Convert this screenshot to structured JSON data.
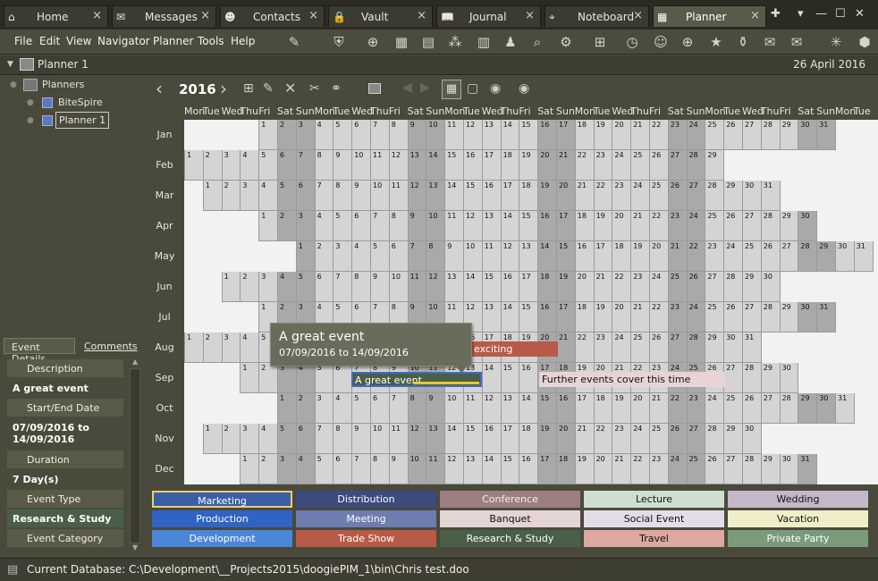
{
  "tabs": [
    {
      "label": "Home",
      "icon": "home-icon",
      "glyph": "⌂",
      "active": false
    },
    {
      "label": "Messages",
      "icon": "envelope-icon",
      "glyph": "✉",
      "active": false
    },
    {
      "label": "Contacts",
      "icon": "contacts-icon",
      "glyph": "☻",
      "active": false
    },
    {
      "label": "Vault",
      "icon": "lock-icon",
      "glyph": "🔒",
      "active": false
    },
    {
      "label": "Journal",
      "icon": "book-icon",
      "glyph": "📖",
      "active": false
    },
    {
      "label": "Noteboard",
      "icon": "pin-icon",
      "glyph": "⌖",
      "active": false
    },
    {
      "label": "Planner",
      "icon": "planner-icon",
      "glyph": "▦",
      "active": true
    }
  ],
  "menu": [
    "File",
    "Edit",
    "View",
    "Navigator",
    "Planner",
    "Tools",
    "Help"
  ],
  "title": {
    "name": "Planner 1",
    "date": "26 April 2016"
  },
  "tree": {
    "root": "Planners",
    "items": [
      "BiteSpire",
      "Planner 1"
    ]
  },
  "calendar": {
    "year": "2016",
    "day_headers": [
      "Mon",
      "Tue",
      "Wed",
      "Thu",
      "Fri",
      "Sat",
      "Sun"
    ],
    "months": [
      "Jan",
      "Feb",
      "Mar",
      "Apr",
      "May",
      "Jun",
      "Jul",
      "Aug",
      "Sep",
      "Oct",
      "Nov",
      "Dec"
    ]
  },
  "detail": {
    "tabs": [
      "Event Details",
      "Comments"
    ],
    "description_label": "Description",
    "description": "A great event",
    "dates_label": "Start/End Date",
    "dates": "07/09/2016 to 14/09/2016",
    "duration_label": "Duration",
    "duration": "7 Day(s)",
    "type_label": "Event Type",
    "type": "Research & Study",
    "category_label": "Event Category"
  },
  "events": {
    "exciting": "exciting",
    "great": "A great event",
    "further": "Further events cover this time"
  },
  "tooltip": {
    "title": "A great event",
    "dates": "07/09/2016 to 14/09/2016"
  },
  "legend": [
    {
      "label": "Marketing",
      "color": "#3c5ea6",
      "text": "#ffffff"
    },
    {
      "label": "Distribution",
      "color": "#3c4a7c",
      "text": "#ffffff"
    },
    {
      "label": "Conference",
      "color": "#9c7e80",
      "text": "#f2f2f2"
    },
    {
      "label": "Lecture",
      "color": "#cfdfcf",
      "text": "#111111"
    },
    {
      "label": "Wedding",
      "color": "#c4b8c8",
      "text": "#111111"
    },
    {
      "label": "Production",
      "color": "#2f63c4",
      "text": "#ffffff"
    },
    {
      "label": "Meeting",
      "color": "#6f7cb0",
      "text": "#ffffff"
    },
    {
      "label": "Banquet",
      "color": "#e4d4d4",
      "text": "#111111"
    },
    {
      "label": "Social Event",
      "color": "#e4dce8",
      "text": "#111111"
    },
    {
      "label": "Vacation",
      "color": "#efeec8",
      "text": "#111111"
    },
    {
      "label": "Development",
      "color": "#4c86d8",
      "text": "#ffffff"
    },
    {
      "label": "Trade Show",
      "color": "#b85a48",
      "text": "#ffffff"
    },
    {
      "label": "Research & Study",
      "color": "#4a5e48",
      "text": "#ffffff"
    },
    {
      "label": "Travel",
      "color": "#dca8a0",
      "text": "#111111"
    },
    {
      "label": "Private Party",
      "color": "#7a9a7c",
      "text": "#ffffff"
    }
  ],
  "status": {
    "text": "Current Database: C:\\Development\\__Projects2015\\doogiePIM_1\\bin\\Chris test.doo"
  }
}
